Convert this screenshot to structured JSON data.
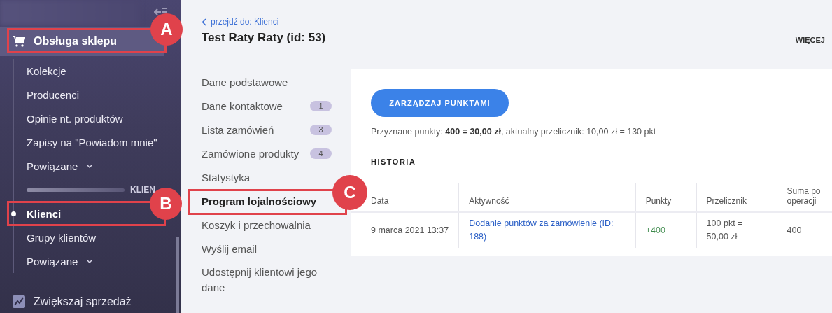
{
  "sidebar": {
    "sections": [
      {
        "label": "Obsługa sklepu",
        "selected": true,
        "callout": "A",
        "children": [
          {
            "kind": "link",
            "label": "Kolekcje",
            "selected": false
          },
          {
            "kind": "link",
            "label": "Producenci",
            "selected": false
          },
          {
            "kind": "link",
            "label": "Opinie nt. produktów",
            "selected": false
          },
          {
            "kind": "link",
            "label": "Zapisy na \"Powiadom mnie\"",
            "selected": false
          },
          {
            "kind": "dropdown",
            "label": "Powiązane",
            "selected": false
          },
          {
            "kind": "heading",
            "label": "KLIEN"
          },
          {
            "kind": "link",
            "label": "Klienci",
            "selected": true,
            "callout": "B"
          },
          {
            "kind": "link",
            "label": "Grupy klientów",
            "selected": false
          },
          {
            "kind": "dropdown",
            "label": "Powiązane",
            "selected": false
          }
        ]
      },
      {
        "label": "Zwiększaj sprzedaż",
        "selected": false
      }
    ]
  },
  "breadcrumb": "przejdź do: Klienci",
  "title": "Test Raty Raty (id: 53)",
  "more": "WIĘCEJ",
  "nav": [
    {
      "label": "Dane podstawowe",
      "selected": false
    },
    {
      "label": "Dane kontaktowe",
      "badge": "1",
      "selected": false
    },
    {
      "label": "Lista zamówień",
      "badge": "3",
      "selected": false
    },
    {
      "label": "Zamówione produkty",
      "badge": "4",
      "selected": false
    },
    {
      "label": "Statystyka",
      "selected": false
    },
    {
      "label": "Program lojalnościowy",
      "selected": true,
      "callout": "C"
    },
    {
      "label": "Koszyk i przechowalnia",
      "selected": false
    },
    {
      "label": "Wyślij email",
      "selected": false
    },
    {
      "label": "Udostępnij klientowi jego dane",
      "selected": false
    }
  ],
  "panel": {
    "button": "ZARZĄDZAJ PUNKTAMI",
    "summary": "Przyznane punkty: **400 = 30,00 zł**, aktualny przelicznik: 10,00 zł = 130 pkt",
    "history_title": "HISTORIA",
    "table": {
      "columns": [
        "Data",
        "Aktywność",
        "Punkty",
        "Przelicznik",
        "Suma po operacji"
      ],
      "rows": [
        {
          "date": "9 marca 2021 13:37",
          "activity": "Dodanie punktów za zamówienie (ID: 188)",
          "points": "+400",
          "rate": "100 pkt = 50,00 zł",
          "total": "400"
        }
      ]
    }
  }
}
